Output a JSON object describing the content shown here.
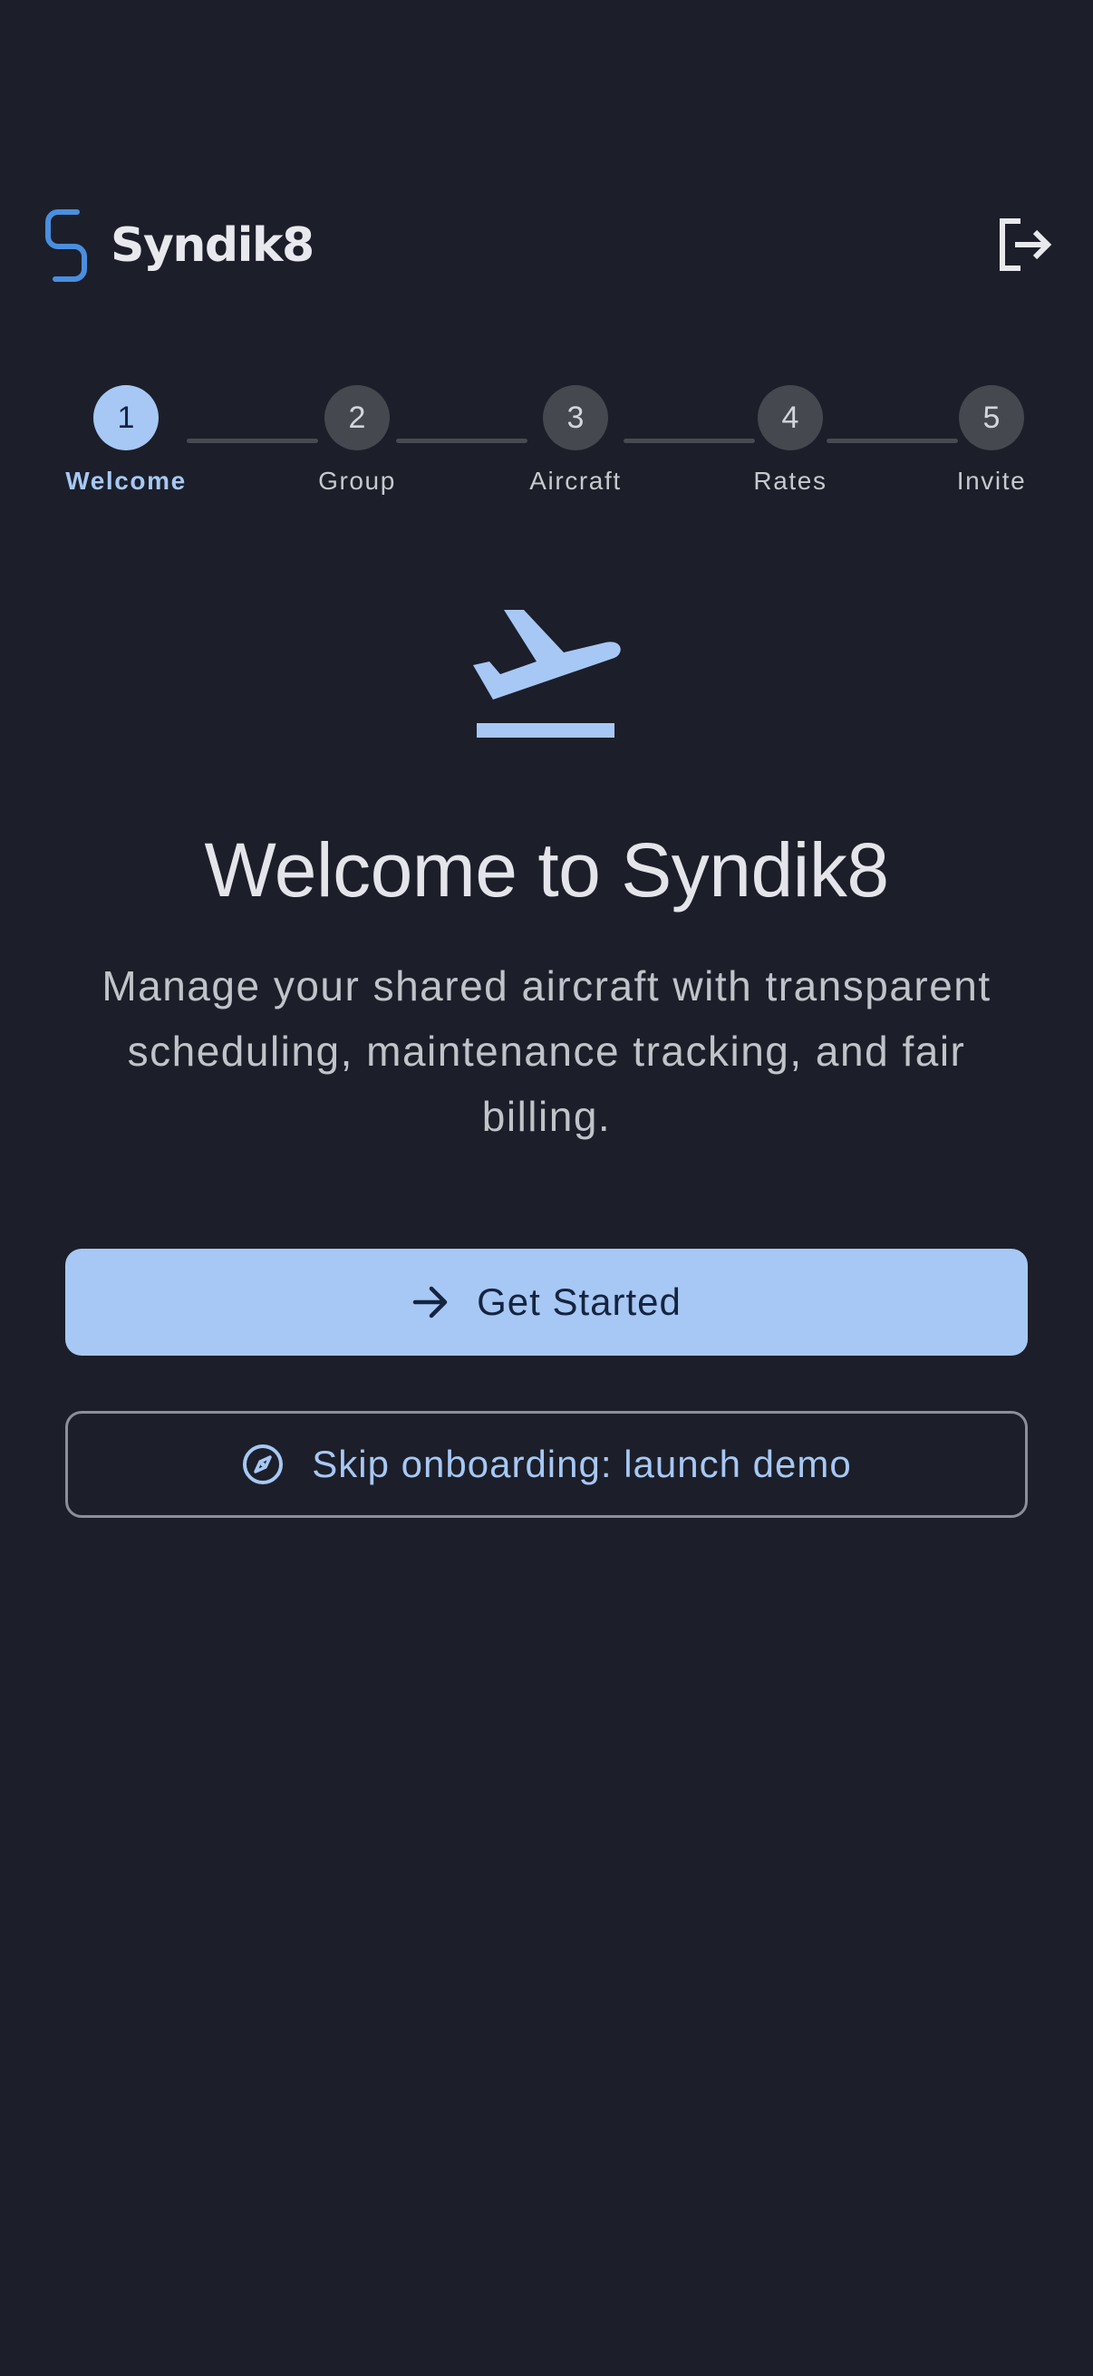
{
  "app": {
    "name": "Syndik8",
    "brand_color": "#4a8ee0",
    "accent_color": "#a7c8f5",
    "background": "#1c1f29"
  },
  "header": {
    "logo_icon": "syndik8-logo-icon",
    "logout_icon": "logout-icon"
  },
  "stepper": {
    "current_step": 1,
    "steps": [
      {
        "number": "1",
        "label": "Welcome",
        "active": true
      },
      {
        "number": "2",
        "label": "Group",
        "active": false
      },
      {
        "number": "3",
        "label": "Aircraft",
        "active": false
      },
      {
        "number": "4",
        "label": "Rates",
        "active": false
      },
      {
        "number": "5",
        "label": "Invite",
        "active": false
      }
    ]
  },
  "hero": {
    "icon": "flight-takeoff-icon",
    "title": "Welcome to Syndik8",
    "subtitle": "Manage your shared aircraft with transparent scheduling, maintenance tracking, and fair billing."
  },
  "actions": {
    "primary_label": "Get Started",
    "primary_icon": "arrow-right-icon",
    "secondary_label": "Skip onboarding: launch demo",
    "secondary_icon": "compass-icon"
  }
}
